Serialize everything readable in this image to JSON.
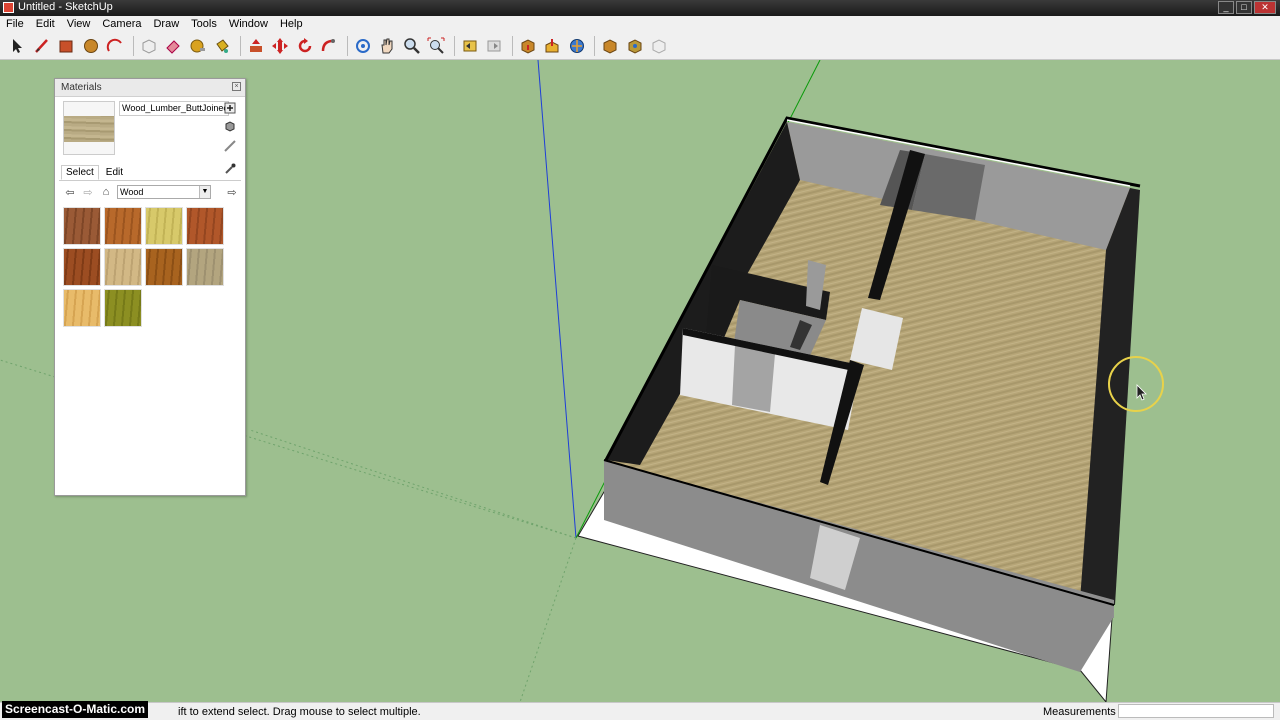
{
  "window": {
    "title": "Untitled - SketchUp"
  },
  "menu": [
    "File",
    "Edit",
    "View",
    "Camera",
    "Draw",
    "Tools",
    "Window",
    "Help"
  ],
  "toolbar": {
    "tools": [
      "select-tool-icon",
      "line-tool-icon",
      "rectangle-tool-icon",
      "circle-tool-icon",
      "arc-tool-icon",
      "make-component-icon",
      "eraser-icon",
      "tape-measure-icon",
      "paint-bucket-icon",
      "push-pull-icon",
      "move-icon",
      "rotate-icon",
      "follow-me-icon",
      "orbit-icon",
      "pan-icon",
      "zoom-icon",
      "zoom-extents-icon",
      "previous-view-icon",
      "next-view-icon",
      "get-models-icon",
      "share-model-icon",
      "place-model-icon",
      "photo-textures-icon",
      "add-location-icon",
      "toggle-terrain-icon"
    ]
  },
  "materials": {
    "title": "Materials",
    "material_name": "Wood_Lumber_ButtJoined",
    "tabs": {
      "select": "Select",
      "edit": "Edit"
    },
    "library": "Wood",
    "swatches": [
      {
        "name": "wood-cherry",
        "color": "#9a5a36",
        "grain": "#7e4627"
      },
      {
        "name": "wood-cherry-original",
        "color": "#b8692b",
        "grain": "#9c551f"
      },
      {
        "name": "wood-light-blond",
        "color": "#d7c96a",
        "grain": "#c2b356"
      },
      {
        "name": "wood-floor",
        "color": "#b1572a",
        "grain": "#944620"
      },
      {
        "name": "wood-floor-dark",
        "color": "#9c4d22",
        "grain": "#7f3b16"
      },
      {
        "name": "wood-veneer-light",
        "color": "#d2b885",
        "grain": "#bda372"
      },
      {
        "name": "wood-walnut",
        "color": "#a8631f",
        "grain": "#8c4f15"
      },
      {
        "name": "wood-lumber-buttjoined",
        "color": "#b3a57f",
        "grain": "#9e9170"
      },
      {
        "name": "wood-pine",
        "color": "#e8bb6a",
        "grain": "#d6a452"
      },
      {
        "name": "wood-olive-green",
        "color": "#8c8f22",
        "grain": "#767a18"
      }
    ]
  },
  "status": {
    "watermark": "Screencast-O-Matic.com",
    "hint": "ift to extend select. Drag mouse to select multiple.",
    "measurements_label": "Measurements"
  },
  "colors": {
    "ground": "#9dbf8f",
    "floor": "#b6a577",
    "wall": "#8c8c8c",
    "wall_dark": "#1e1e1e"
  }
}
